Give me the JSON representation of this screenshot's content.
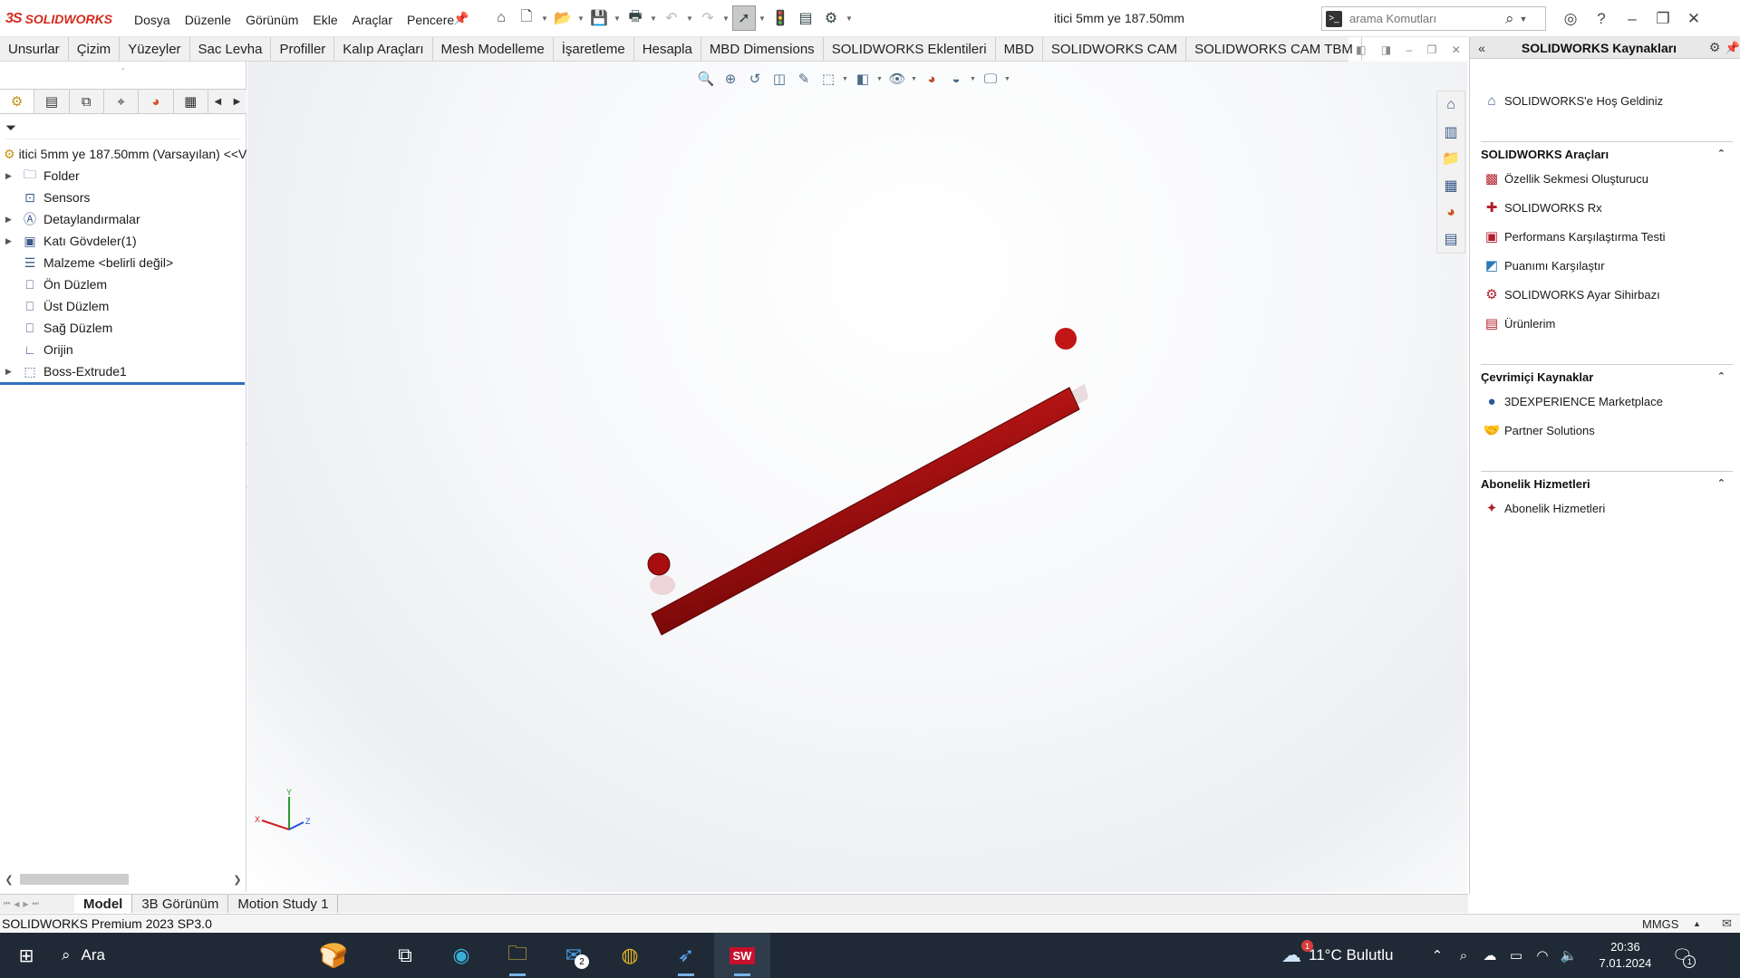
{
  "app": {
    "logo_text": "SOLIDWORKS",
    "logo_ds": "3S",
    "menus": [
      "Dosya",
      "Düzenle",
      "Görünüm",
      "Ekle",
      "Araçlar",
      "Pencere"
    ],
    "document_title": "itici 5mm ye 187.50mm",
    "search_placeholder": "arama Komutları",
    "accent_color": "#d52b1e"
  },
  "command_tabs": [
    "Unsurlar",
    "Çizim",
    "Yüzeyler",
    "Sac Levha",
    "Profiller",
    "Kalıp Araçları",
    "Mesh Modelleme",
    "İşaretleme",
    "Hesapla",
    "MBD Dimensions",
    "SOLIDWORKS Eklentileri",
    "MBD",
    "SOLIDWORKS CAM",
    "SOLIDWORKS CAM TBM"
  ],
  "feature_tree": {
    "root": "itici 5mm ye 187.50mm (Varsayılan) <<V",
    "items": [
      {
        "label": "Folder",
        "icon": "folder-icon",
        "expandable": true
      },
      {
        "label": "Sensors",
        "icon": "sensor-icon",
        "expandable": false
      },
      {
        "label": "Detaylandırmalar",
        "icon": "annotation-icon",
        "expandable": true
      },
      {
        "label": "Katı Gövdeler(1)",
        "icon": "solid-bodies-icon",
        "expandable": true
      },
      {
        "label": "Malzeme <belirli değil>",
        "icon": "material-icon",
        "expandable": false
      },
      {
        "label": "Ön Düzlem",
        "icon": "plane-icon",
        "expandable": false
      },
      {
        "label": "Üst Düzlem",
        "icon": "plane-icon",
        "expandable": false
      },
      {
        "label": "Sağ Düzlem",
        "icon": "plane-icon",
        "expandable": false
      },
      {
        "label": "Orijin",
        "icon": "origin-icon",
        "expandable": false
      },
      {
        "label": "Boss-Extrude1",
        "icon": "extrude-icon",
        "expandable": true
      }
    ]
  },
  "model": {
    "part_color": "#b01010",
    "part_highlight": "#e23a3a"
  },
  "triad": {
    "x": "X",
    "y": "Y",
    "z": "Z"
  },
  "resources": {
    "title": "SOLIDWORKS Kaynakları",
    "welcome": "SOLIDWORKS'e Hoş Geldiniz",
    "sections": [
      {
        "title": "SOLIDWORKS Araçları",
        "items": [
          "Özellik Sekmesi Oluşturucu",
          "SOLIDWORKS Rx",
          "Performans Karşılaştırma Testi",
          "Puanımı Karşılaştır",
          "SOLIDWORKS Ayar Sihirbazı",
          "Ürünlerim"
        ]
      },
      {
        "title": "Çevrimiçi Kaynaklar",
        "items": [
          "3DEXPERIENCE Marketplace",
          "Partner Solutions"
        ]
      },
      {
        "title": "Abonelik Hizmetleri",
        "items": [
          "Abonelik Hizmetleri"
        ]
      }
    ]
  },
  "bottom_tabs": [
    "Model",
    "3B Görünüm",
    "Motion Study 1"
  ],
  "status": {
    "version": "SOLIDWORKS Premium 2023 SP3.0",
    "units": "MMGS"
  },
  "taskbar": {
    "search_label": "Ara",
    "mail_badge": "2",
    "weather": "11°C  Bulutlu",
    "weather_badge": "1",
    "time": "20:36",
    "date": "7.01.2024",
    "notification_count": "1"
  }
}
